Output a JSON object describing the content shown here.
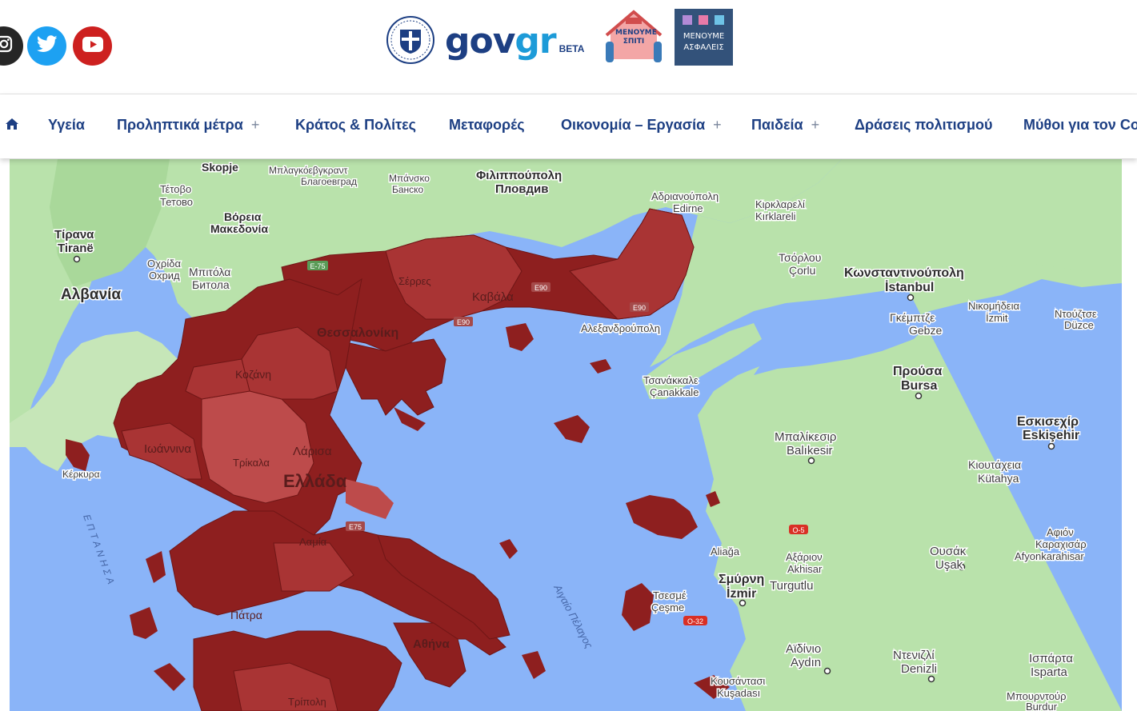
{
  "header": {
    "logo": {
      "text_gov": "gov",
      "text_gr": "gr",
      "beta": "BETA"
    },
    "badges": [
      {
        "lines": [
          "ΜΕΝΟΥΜΕ",
          "ΣΠΙΤΙ"
        ]
      },
      {
        "lines": [
          "ΜΕΝΟΥΜΕ",
          "ΑΣΦΑΛΕΙΣ"
        ]
      }
    ],
    "social": [
      {
        "icon": "instagram-icon",
        "color": "#262626"
      },
      {
        "icon": "twitter-icon",
        "color": "#1da1f2"
      },
      {
        "icon": "youtube-icon",
        "color": "#cd201f"
      }
    ]
  },
  "nav": {
    "home_icon": "home-icon",
    "items": [
      {
        "label": "Υγεία",
        "has_submenu": false
      },
      {
        "label": "Προληπτικά μέτρα",
        "has_submenu": true
      },
      {
        "label": "Κράτος & Πολίτες",
        "has_submenu": false
      },
      {
        "label": "Μεταφορές",
        "has_submenu": false
      },
      {
        "label": "Οικονομία – Εργασία",
        "has_submenu": true
      },
      {
        "label": "Παιδεία",
        "has_submenu": true
      },
      {
        "label": "Δράσεις πολιτισμού",
        "has_submenu": false
      },
      {
        "label": "Μύθοι για τον Co",
        "has_submenu": false
      }
    ],
    "submenu_symbol": "+"
  },
  "map": {
    "colors": {
      "sea": "#8ab4f8",
      "land": "#b9e2ab",
      "region_dark": "#8e1f1f",
      "region_mid": "#a93434",
      "region_light": "#bd4b4b"
    },
    "labels": {
      "skopje": "Skopje",
      "blagoevgrad_gr": "Μπλαγκόεβγκραντ",
      "blagoevgrad_bg": "Благоевград",
      "bansko_gr": "Μπάνσκο",
      "bansko_bg": "Банско",
      "plovdiv_gr": "Φιλιππούπολη",
      "plovdiv_bg": "Пловдив",
      "tetovo_gr": "Τέτοβο",
      "tetovo_mk": "Тетово",
      "north_mk": "Βόρεια",
      "north_mk2": "Μακεδονία",
      "tirana_gr": "Τίρανα",
      "tirana": "Tiranë",
      "ohrid_gr": "Οχρίδα",
      "ohrid_mk": "Охрид",
      "bitola_gr": "Μπιτόλα",
      "bitola_mk": "Битола",
      "albania": "Αλβανία",
      "edirne_gr": "Αδριανούπολη",
      "edirne": "Edirne",
      "kirklareli_gr": "Κιρκλαρελί",
      "kirklareli": "Kırklareli",
      "corlu_gr": "Τσόρλου",
      "corlu": "Çorlu",
      "istanbul_gr": "Κωνσταντινούπολη",
      "istanbul": "İstanbul",
      "nikomideia": "Νικομήδεια",
      "izmit": "İzmit",
      "duzce_gr": "Ντούζτσε",
      "duzce": "Düzce",
      "gebze_gr": "Γκέμπτζε",
      "gebze": "Gebze",
      "bursa_gr": "Προύσα",
      "bursa": "Bursa",
      "canakkale_gr": "Τσανάκκαλε",
      "canakkale": "Çanakkale",
      "balikesir_gr": "Μπαλίκεσιρ",
      "balikesir": "Balıkesir",
      "eskisehir_gr": "Εσκισεχίρ",
      "eskisehir": "Eskişehir",
      "kutahya_gr": "Κιουτάχεια",
      "kutahya": "Kütahya",
      "afyon_gr1": "Αφιόν",
      "afyon_gr2": "Καραχισάρ",
      "afyon": "Afyonkarahisar",
      "usak_gr": "Ουσάκ",
      "usak": "Uşak",
      "aliaga": "Aliağa",
      "akhisar_gr": "Αξάριον",
      "akhisar": "Akhisar",
      "izmir_gr": "Σμύρνη",
      "izmir": "İzmir",
      "turgutlu": "Turgutlu",
      "cesme_gr": "Τσεσμέ",
      "cesme": "Çeşme",
      "aydin_gr": "Αϊδίνιο",
      "aydin": "Aydın",
      "denizli_gr": "Ντενιζλί",
      "denizli": "Denizli",
      "isparta_gr": "Ισπάρτα",
      "isparta": "Isparta",
      "kusadasi_gr": "Κουσάντασι",
      "kusadasi": "Kuşadası",
      "burdur_gr": "Μπουρντούρ",
      "burdur": "Burdur",
      "serres": "Σέρρες",
      "kavala": "Καβάλα",
      "alexandroupoli": "Αλεξανδρούπολη",
      "thessaloniki": "Θεσσαλονίκη",
      "kozani": "Κοζάνη",
      "ioannina": "Ιωάννινα",
      "trikala": "Τρίκαλα",
      "larisa": "Λάρισα",
      "kerkyra": "Κέρκυρα",
      "greece": "Ελλάδα",
      "lamia": "Λαμία",
      "patra": "Πάτρα",
      "athina": "Αθήνα",
      "tripoli": "Τρίπολη",
      "ionian": "ΕΠΤΑΝΗΣΑ",
      "aegean": "Αιγαίο Πέλαγος"
    },
    "roads": [
      "E-75",
      "E90",
      "E90",
      "E90",
      "E75",
      "O-5",
      "O-32"
    ]
  }
}
